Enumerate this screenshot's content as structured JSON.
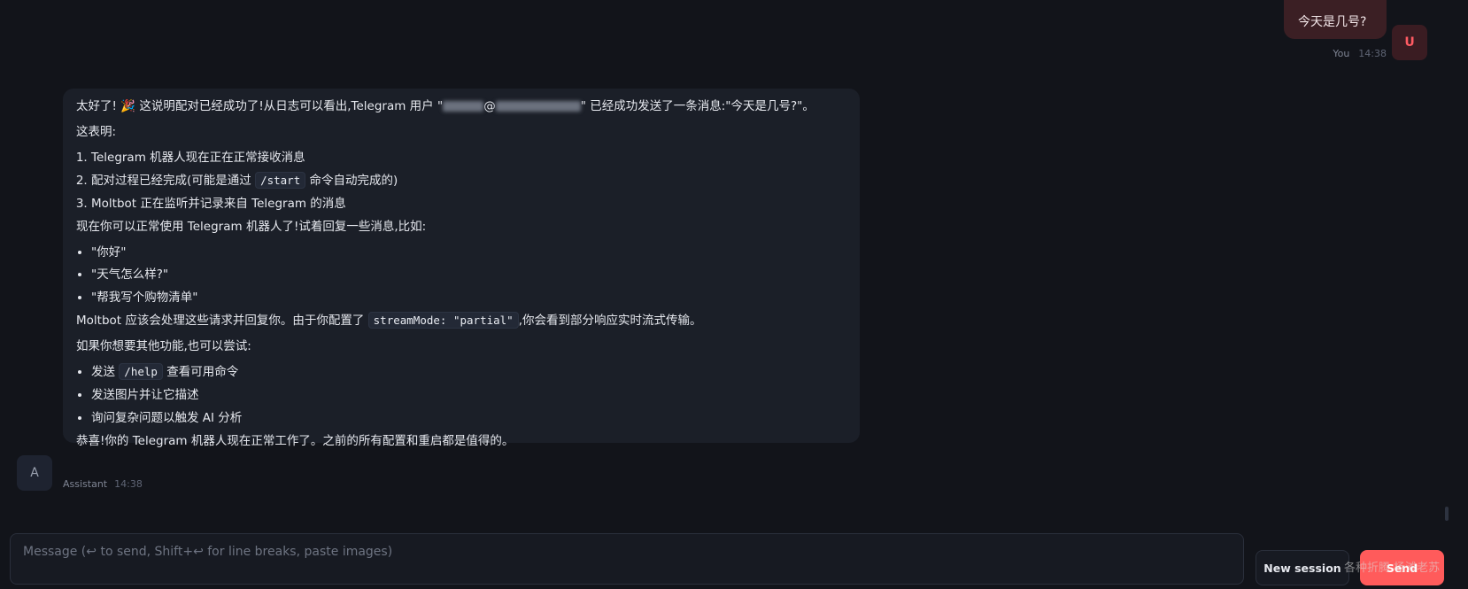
{
  "user_message": {
    "text": "今天是几号?",
    "sender": "You",
    "time": "14:38",
    "avatar": "U"
  },
  "assistant_message": {
    "avatar": "A",
    "sender": "Assistant",
    "time": "14:38",
    "line1_before": "太好了!",
    "emoji": "🎉",
    "line1_after": " 这说明配对已经成功了!从日志可以看出,Telegram 用户 \"",
    "line1_mid": "@",
    "line1_end": "\" 已经成功发送了一条消息:\"今天是几号?\"。",
    "intro": "这表明:",
    "ordered_items": [
      "Telegram 机器人现在正在正常接收消息",
      "配对过程已经完成(可能是通过 ",
      "Moltbot 正在监听并记录来自 Telegram 的消息"
    ],
    "ordered_item2_code": "/start",
    "ordered_item2_after": " 命令自动完成的)",
    "usage_line": "现在你可以正常使用 Telegram 机器人了!试着回复一些消息,比如:",
    "examples": [
      "\"你好\"",
      "\"天气怎么样?\"",
      "\"帮我写个购物清单\""
    ],
    "stream_before": "Moltbot 应该会处理这些请求并回复你。由于你配置了 ",
    "stream_code": "streamMode: \"partial\"",
    "stream_after": ",你会看到部分响应实时流式传输。",
    "try_line": "如果你想要其他功能,也可以尝试:",
    "try_item1_before": "发送 ",
    "try_item1_code": "/help",
    "try_item1_after": " 查看可用命令",
    "try_item2": "发送图片并让它描述",
    "try_item3": "询问复杂问题以触发 AI 分析",
    "congrats": "恭喜!你的 Telegram 机器人现在正常工作了。之前的所有配置和重启都是值得的。"
  },
  "composer": {
    "placeholder": "Message (↩ to send, Shift+↩ for line breaks, paste images)"
  },
  "buttons": {
    "new_session": "New session",
    "send": "Send"
  },
  "watermark": "各种折腾 杨滩老苏",
  "colors": {
    "background": "#12141a",
    "accent": "#ff5b5b",
    "user_bubble": "#3b1f24",
    "assistant_bubble": "#1b1f28"
  }
}
